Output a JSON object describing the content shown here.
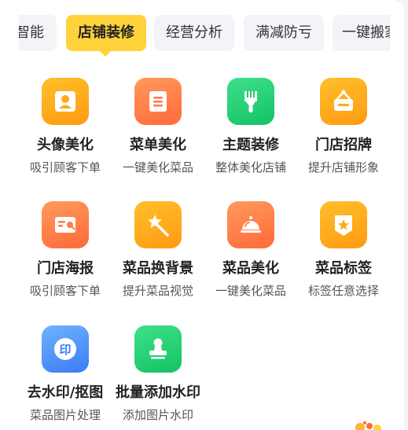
{
  "tabs": [
    {
      "label": "智能"
    },
    {
      "label": "店铺装修"
    },
    {
      "label": "经营分析"
    },
    {
      "label": "满减防亏"
    },
    {
      "label": "一键搬家"
    }
  ],
  "features": [
    {
      "title": "头像美化",
      "sub": "吸引顾客下单",
      "icon": "avatar-frame-icon"
    },
    {
      "title": "菜单美化",
      "sub": "一键美化菜品",
      "icon": "menu-list-icon"
    },
    {
      "title": "主题装修",
      "sub": "整体美化店铺",
      "icon": "paint-brush-icon"
    },
    {
      "title": "门店招牌",
      "sub": "提升店铺形象",
      "icon": "signboard-icon"
    },
    {
      "title": "门店海报",
      "sub": "吸引顾客下单",
      "icon": "poster-icon"
    },
    {
      "title": "菜品换背景",
      "sub": "提升菜品视觉",
      "icon": "magic-wand-icon"
    },
    {
      "title": "菜品美化",
      "sub": "一键美化菜品",
      "icon": "dish-cloche-icon"
    },
    {
      "title": "菜品标签",
      "sub": "标签任意选择",
      "icon": "star-badge-icon"
    },
    {
      "title": "去水印/抠图",
      "sub": "菜品图片处理",
      "icon": "watermark-remove-icon",
      "glyph": "印"
    },
    {
      "title": "批量添加水印",
      "sub": "添加图片水印",
      "icon": "stamp-icon"
    }
  ],
  "colors": {
    "accent": "#ffd23a",
    "orange": "#ff9a12",
    "red": "#ff6a3a",
    "green": "#14c264",
    "blue": "#3a7cf5"
  }
}
